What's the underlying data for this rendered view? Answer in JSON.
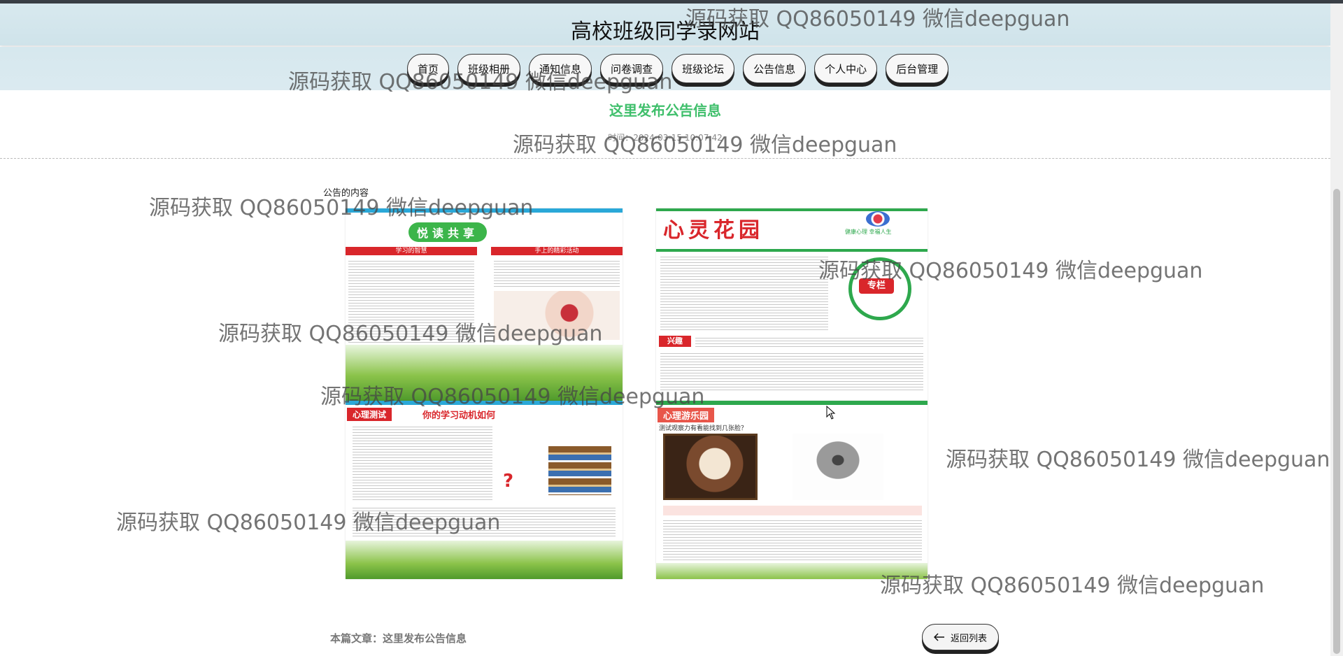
{
  "site": {
    "title": "高校班级同学录网站"
  },
  "nav": [
    {
      "label": "首页"
    },
    {
      "label": "班级相册"
    },
    {
      "label": "通知信息"
    },
    {
      "label": "问卷调查"
    },
    {
      "label": "班级论坛"
    },
    {
      "label": "公告信息"
    },
    {
      "label": "个人中心"
    },
    {
      "label": "后台管理"
    }
  ],
  "article": {
    "title": "这里发布公告信息",
    "meta": "时间：2024-03-15 10:07:42",
    "content_label": "公告的内容",
    "footer_label": "本篇文章：这里发布公告信息"
  },
  "posters": {
    "p1_heading": "悦读共享",
    "p1_sub_left": "学习的智慧",
    "p1_sub_right": "手上的精彩活动",
    "p2_heading": "心灵花园",
    "p2_logo_text": "健康心理 幸福人生",
    "p2_badge": "专栏",
    "p2_section": "兴趣",
    "p3_heading_left": "心理测试",
    "p3_heading_right": "你的学习动机如何",
    "p4_heading": "心理游乐园",
    "p4_caption": "测试观察力有看能找到几张脸？"
  },
  "back_button": {
    "label": "返回列表"
  },
  "watermark": {
    "text": "源码获取 QQ86050149 微信deepguan"
  },
  "colors": {
    "accent_green": "#3fbf6b",
    "header_bg": "#d6e8ee",
    "poster_red": "#d9262b",
    "poster_green": "#2ea84d"
  },
  "icons": {
    "back": "arrow-left-icon",
    "cursor": "mouse-pointer-icon"
  }
}
